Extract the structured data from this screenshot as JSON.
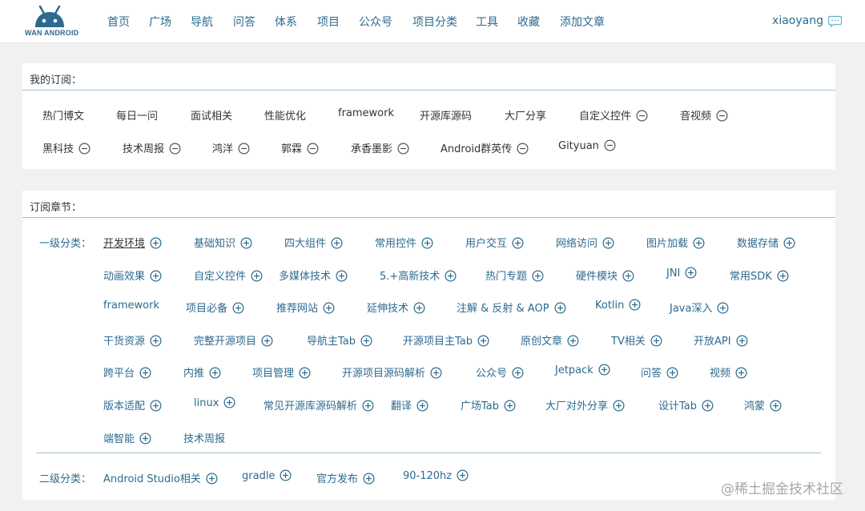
{
  "header": {
    "logo_text": "WAN ANDROID",
    "nav": [
      "首页",
      "广场",
      "导航",
      "问答",
      "体系",
      "项目",
      "公众号",
      "项目分类",
      "工具",
      "收藏",
      "添加文章"
    ],
    "username": "xiaoyang"
  },
  "subscriptions": {
    "title": "我的订阅：",
    "items": [
      {
        "label": "热门博文",
        "removable": false
      },
      {
        "label": "每日一问",
        "removable": false
      },
      {
        "label": "面试相关",
        "removable": false
      },
      {
        "label": "性能优化",
        "removable": false
      },
      {
        "label": "framework",
        "removable": false
      },
      {
        "label": "开源库源码",
        "removable": false
      },
      {
        "label": "大厂分享",
        "removable": false
      },
      {
        "label": "自定义控件",
        "removable": true
      },
      {
        "label": "音视频",
        "removable": true
      },
      {
        "label": "黑科技",
        "removable": true
      },
      {
        "label": "技术周报",
        "removable": true
      },
      {
        "label": "鸿洋",
        "removable": true
      },
      {
        "label": "郭霖",
        "removable": true
      },
      {
        "label": "承香墨影",
        "removable": true
      },
      {
        "label": "Android群英传",
        "removable": true
      },
      {
        "label": "Gityuan",
        "removable": true
      }
    ]
  },
  "chapters": {
    "title": "订阅章节：",
    "level1_label": "一级分类：",
    "level1_selected": "开发环境",
    "level1": [
      "开发环境",
      "基础知识",
      "四大组件",
      "常用控件",
      "用户交互",
      "网络访问",
      "图片加载",
      "数据存储",
      "动画效果",
      "自定义控件",
      "多媒体技术",
      "5.+高新技术",
      "热门专题",
      "硬件模块",
      "JNI",
      "常用SDK",
      "framework",
      "项目必备",
      "推荐网站",
      "延伸技术",
      "注解 & 反射 & AOP",
      "Kotlin",
      "Java深入",
      "干货资源",
      "完整开源项目",
      "导航主Tab",
      "开源项目主Tab",
      "原创文章",
      "TV相关",
      "开放API",
      "跨平台",
      "内推",
      "项目管理",
      "开源项目源码解析",
      "公众号",
      "Jetpack",
      "问答",
      "视频",
      "版本适配",
      "linux",
      "常见开源库源码解析",
      "翻译",
      "广场Tab",
      "大厂对外分享",
      "设计Tab",
      "鸿蒙",
      "端智能",
      "技术周报"
    ],
    "level2_label": "二级分类：",
    "level2": [
      "Android Studio相关",
      "gradle",
      "官方发布",
      "90-120hz"
    ]
  },
  "watermark": "@稀土掘金技术社区",
  "colors": {
    "link": "#2d6a8f",
    "text": "#333333",
    "divider": "#9ac1d3",
    "background": "#f1f1f1"
  }
}
